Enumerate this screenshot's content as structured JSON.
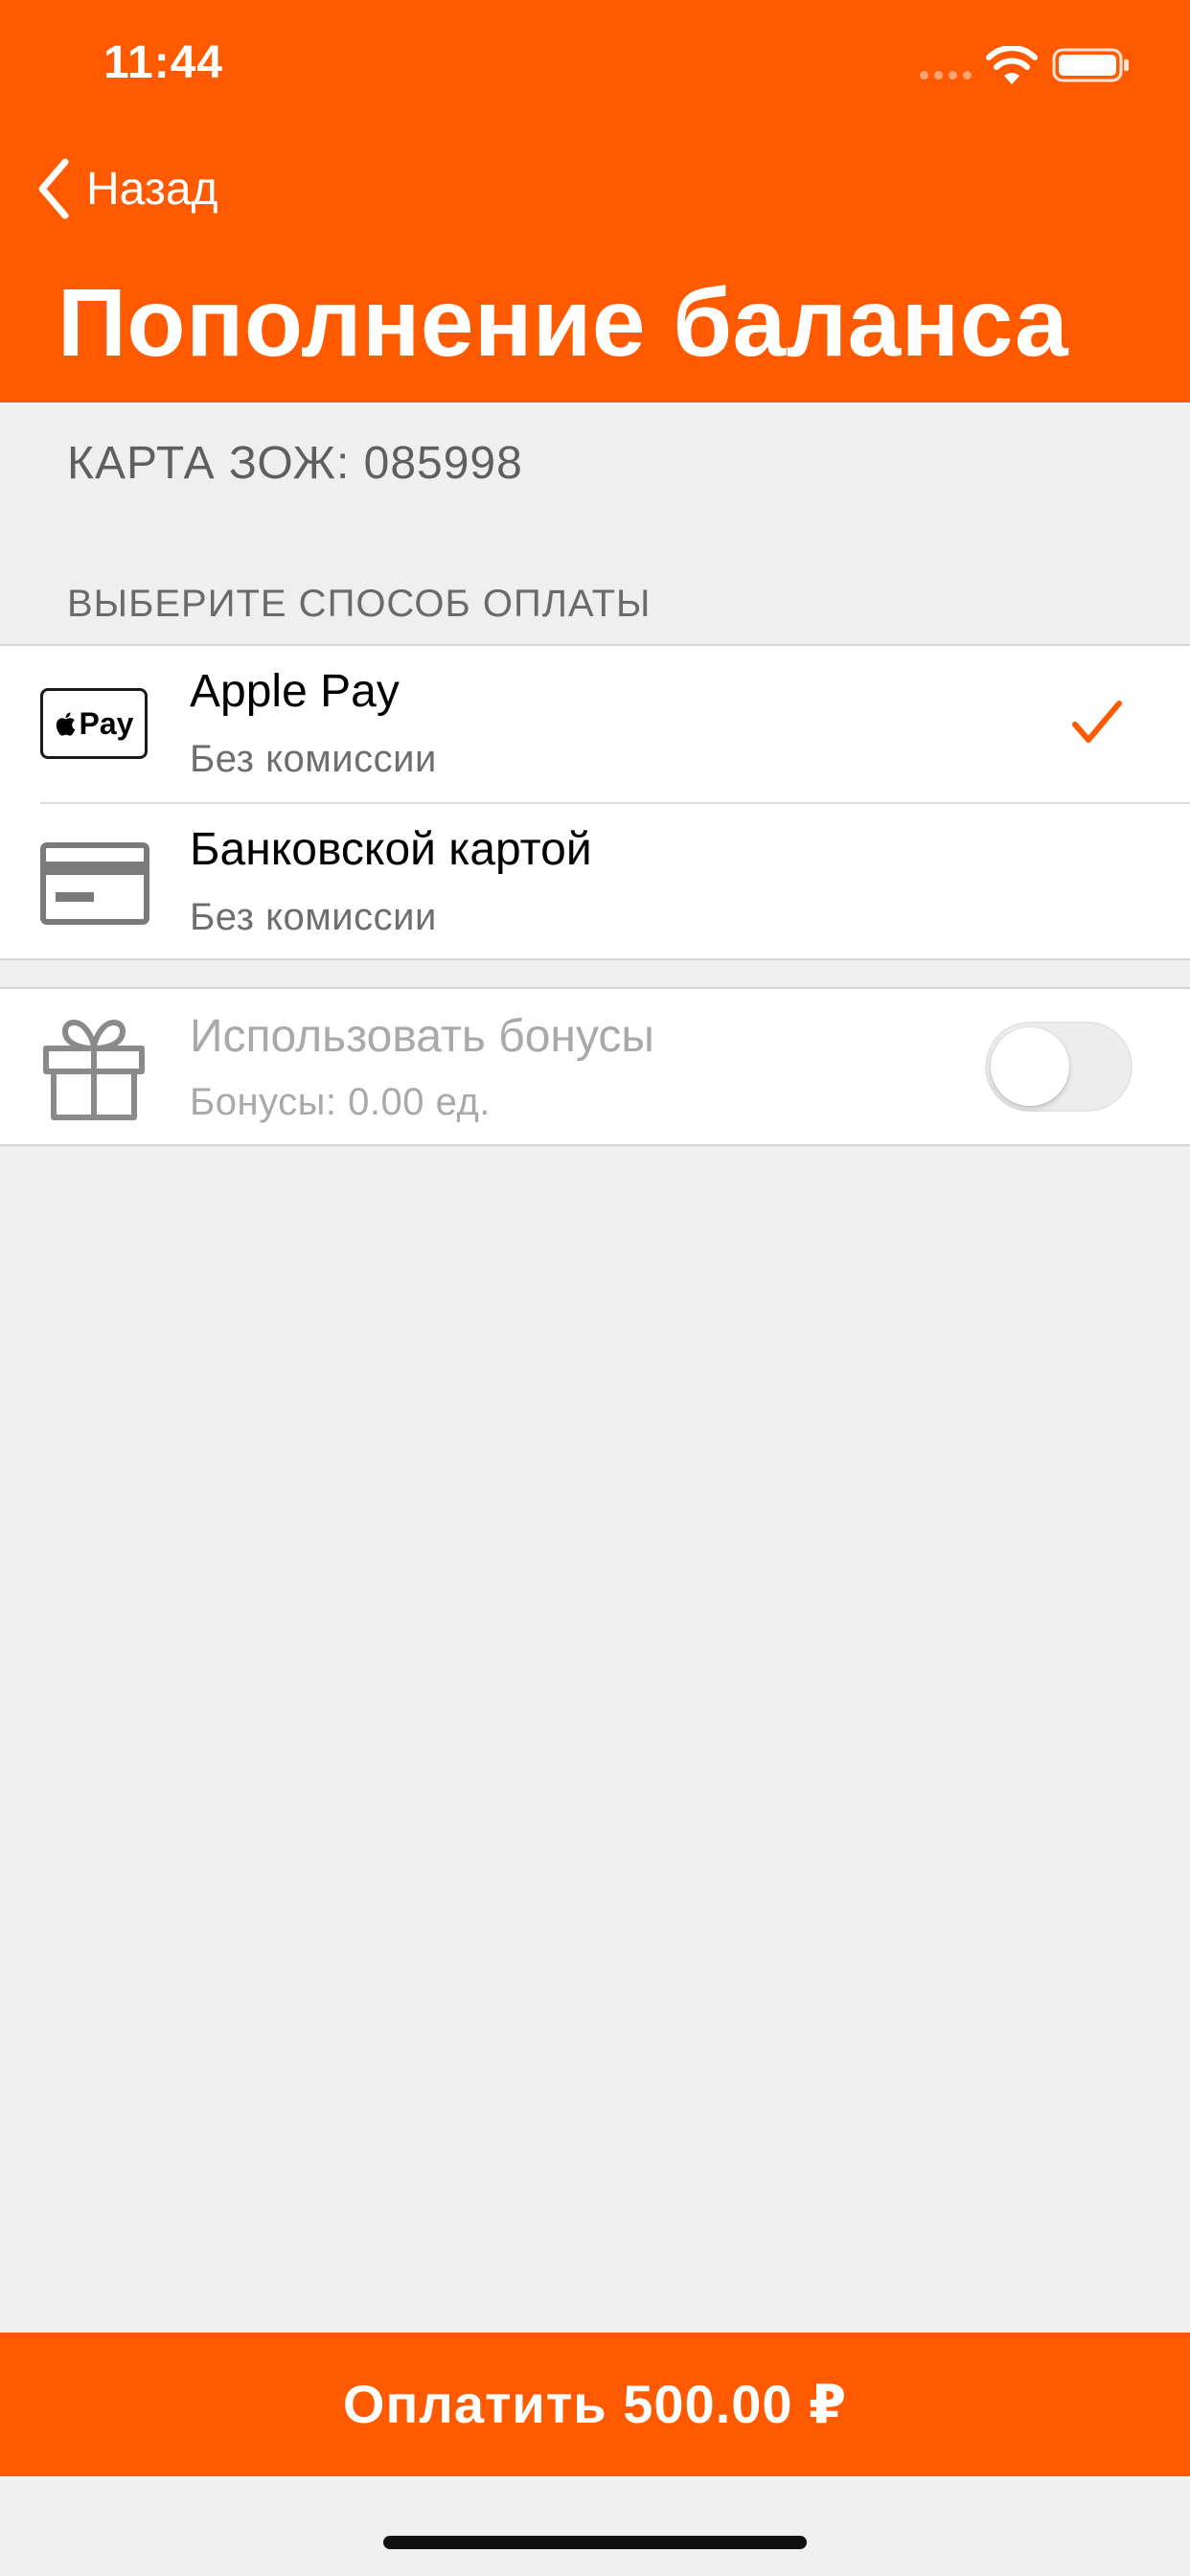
{
  "status_bar": {
    "time": "11:44",
    "icons": [
      "cellular-signal-icon",
      "wifi-icon",
      "battery-icon"
    ]
  },
  "nav": {
    "back_label": "Назад",
    "back_icon": "chevron-left-icon",
    "title": "Пополнение баланса"
  },
  "card": {
    "label": "КАРТА ЗОЖ: 085998"
  },
  "payment_section": {
    "header": "ВЫБЕРИТЕ СПОСОБ ОПЛАТЫ",
    "options": [
      {
        "title": "Apple Pay",
        "subtitle": "Без комиссии",
        "icon": "apple-pay-icon",
        "selected": true
      },
      {
        "title": "Банковской картой",
        "subtitle": "Без комиссии",
        "icon": "bank-card-icon",
        "selected": false
      }
    ]
  },
  "bonus": {
    "title": "Использовать бонусы",
    "subtitle": "Бонусы: 0.00 ед.",
    "icon": "gift-icon",
    "enabled": false,
    "toggle_on": false
  },
  "apple_pay_mark_text": "Pay",
  "pay_button": {
    "label": "Оплатить 500.00 ₽"
  },
  "colors": {
    "accent": "#ff5a00",
    "background": "#efefef",
    "surface": "#ffffff",
    "secondary_text": "#6e6e6e",
    "disabled_text": "#a9a9a9"
  }
}
